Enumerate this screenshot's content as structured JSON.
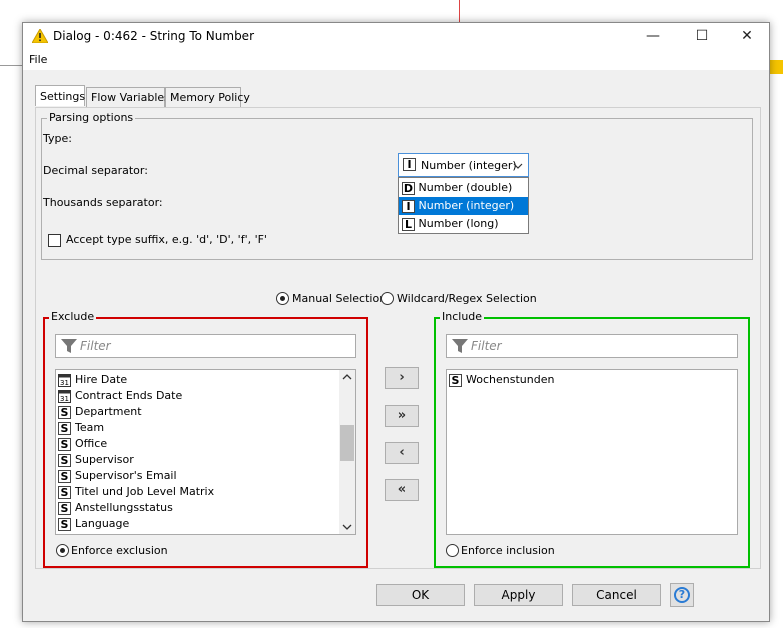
{
  "window": {
    "title": "Dialog - 0:462 - String To Number"
  },
  "menu": {
    "file": "File"
  },
  "tabs": [
    {
      "label": "Settings",
      "active": true
    },
    {
      "label": "Flow Variables",
      "active": false
    },
    {
      "label": "Memory Policy",
      "active": false
    }
  ],
  "parsing": {
    "group_label": "Parsing options",
    "type_label": "Type:",
    "type_selected": "Number (integer)",
    "type_selected_badge": "I",
    "type_options": [
      {
        "badge": "D",
        "label": "Number (double)",
        "selected": false
      },
      {
        "badge": "I",
        "label": "Number (integer)",
        "selected": true
      },
      {
        "badge": "L",
        "label": "Number (long)",
        "selected": false
      }
    ],
    "decimal_label": "Decimal separator:",
    "thousands_label": "Thousands separator:",
    "suffix_label": "Accept type suffix, e.g. 'd', 'D', 'f', 'F'"
  },
  "selection_mode": {
    "manual": "Manual Selection",
    "wildcard": "Wildcard/Regex Selection",
    "selected": "manual"
  },
  "exclude": {
    "label": "Exclude",
    "filter_placeholder": "Filter",
    "items": [
      {
        "type": "date",
        "label": "Hire Date"
      },
      {
        "type": "date",
        "label": "Contract Ends Date"
      },
      {
        "type": "S",
        "label": "Department"
      },
      {
        "type": "S",
        "label": "Team"
      },
      {
        "type": "S",
        "label": "Office"
      },
      {
        "type": "S",
        "label": "Supervisor"
      },
      {
        "type": "S",
        "label": "Supervisor's Email"
      },
      {
        "type": "S",
        "label": "Titel und Job Level Matrix"
      },
      {
        "type": "S",
        "label": "Anstellungsstatus"
      },
      {
        "type": "S",
        "label": "Language"
      }
    ],
    "enforce_label": "Enforce exclusion",
    "enforce_selected": true,
    "color": "#d00000"
  },
  "include": {
    "label": "Include",
    "filter_placeholder": "Filter",
    "items": [
      {
        "type": "S",
        "label": "Wochenstunden"
      }
    ],
    "enforce_label": "Enforce inclusion",
    "enforce_selected": false,
    "color": "#00c000"
  },
  "move_buttons": {
    "add": "›",
    "add_all": "»",
    "remove": "‹",
    "remove_all": "«"
  },
  "buttons": {
    "ok": "OK",
    "apply": "Apply",
    "cancel": "Cancel"
  },
  "colors": {
    "selection": "#0078d7",
    "focus_border": "#4a90d9"
  }
}
